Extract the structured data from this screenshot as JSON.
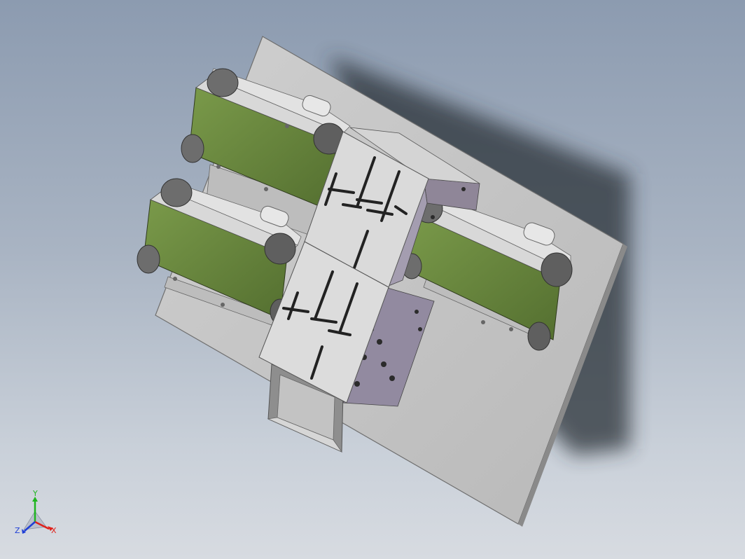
{
  "viewport": {
    "background_top": "#8c9bb0",
    "background_bottom": "#d7dbe1"
  },
  "model": {
    "plate_color": "#c8c8c8",
    "belt_color": "#6a8a3e",
    "frame_color": "#d9d9d9",
    "housing_color": "#9a8fa6",
    "dark_part_color": "#5c5c5c"
  },
  "triad": {
    "x_label": "X",
    "y_label": "Y",
    "z_label": "Z",
    "x_color": "#e0231c",
    "y_color": "#1fb51f",
    "z_color": "#1f3fd6"
  }
}
